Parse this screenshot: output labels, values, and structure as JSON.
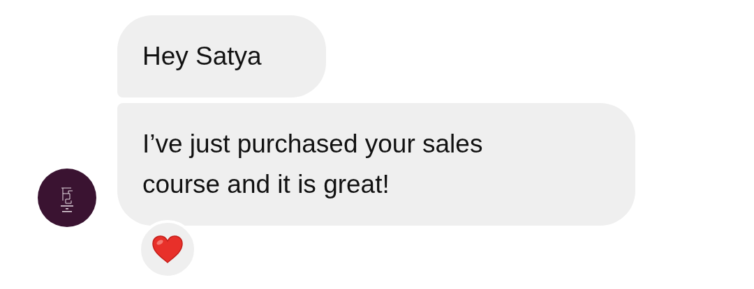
{
  "messages": [
    {
      "lines": [
        "Hey Satya"
      ]
    },
    {
      "lines": [
        "I’ve just purchased your sales",
        "course and it is great!"
      ]
    }
  ]
}
